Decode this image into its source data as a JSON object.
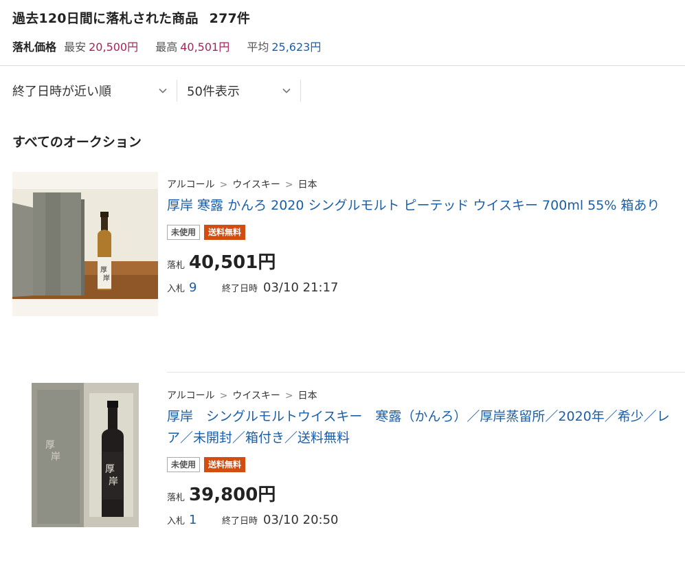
{
  "summary": {
    "title": "過去120日間に落札された商品",
    "count": "277件",
    "price_label": "落札価格",
    "low_label": "最安",
    "low_value": "20,500円",
    "high_label": "最高",
    "high_value": "40,501円",
    "avg_label": "平均",
    "avg_value": "25,623円"
  },
  "sort": {
    "order": "終了日時が近い順",
    "per_page": "50件表示"
  },
  "section_title": "すべてのオークション",
  "items": [
    {
      "crumbs": [
        "アルコール",
        "ウイスキー",
        "日本"
      ],
      "title": "厚岸 寒露 かんろ 2020 シングルモルト ピーテッド ウイスキー 700ml 55% 箱あり",
      "badge_condition": "未使用",
      "badge_shipping": "送料無料",
      "price_label": "落札",
      "price": "40,501円",
      "bids_label": "入札",
      "bids": "9",
      "end_label": "終了日時",
      "end": "03/10 21:17"
    },
    {
      "crumbs": [
        "アルコール",
        "ウイスキー",
        "日本"
      ],
      "title": "厚岸　シングルモルトウイスキー　寒露（かんろ）／厚岸蒸留所／2020年／希少／レア／未開封／箱付き／送料無料",
      "badge_condition": "未使用",
      "badge_shipping": "送料無料",
      "price_label": "落札",
      "price": "39,800円",
      "bids_label": "入札",
      "bids": "1",
      "end_label": "終了日時",
      "end": "03/10 20:50"
    }
  ],
  "icons": {
    "chevron": "chevron-down-icon",
    "crumb_separator": ">"
  },
  "colors": {
    "link": "#1a5ea8",
    "price_accent": "#a3245a",
    "shipping_badge": "#d24d0f"
  }
}
